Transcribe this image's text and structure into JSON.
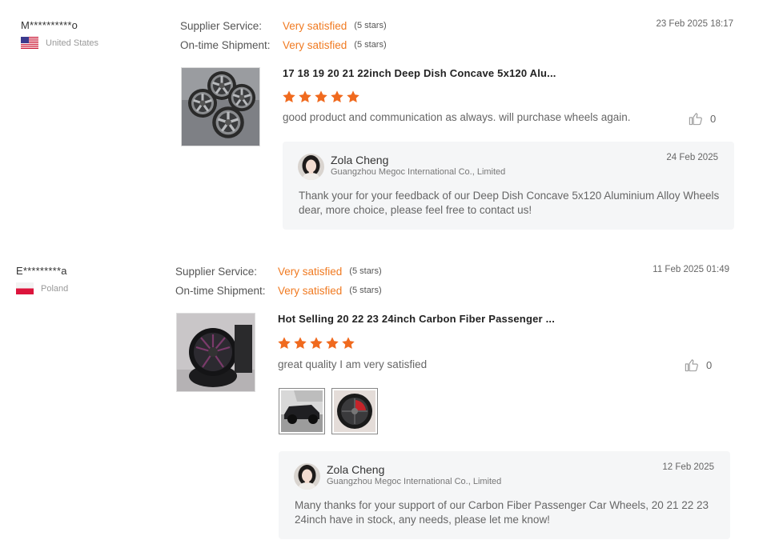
{
  "reviews": [
    {
      "buyer_name": "M**********o",
      "country": "United States",
      "flag": "us-flag",
      "supplier_service_label": "Supplier Service:",
      "supplier_service_value": "Very satisfied",
      "supplier_service_stars": "(5 stars)",
      "shipment_label": "On-time Shipment:",
      "shipment_value": "Very satisfied",
      "shipment_stars": "(5 stars)",
      "date": "23 Feb 2025 18:17",
      "product_title": "17 18 19 20 21 22inch Deep Dish Concave 5x120 Alu...",
      "rating": 5,
      "comment": "good product and communication as always. will purchase wheels again.",
      "likes": "0",
      "reply": {
        "name": "Zola Cheng",
        "company": "Guangzhou Megoc International Co., Limited",
        "date": "24 Feb 2025",
        "text": "Thank your for your feedback of our Deep Dish Concave 5x120 Aluminium Alloy Wheels dear, more choice, please feel free to contact us!"
      }
    },
    {
      "buyer_name": "E*********a",
      "country": "Poland",
      "flag": "poland-flag",
      "supplier_service_label": "Supplier Service:",
      "supplier_service_value": "Very satisfied",
      "supplier_service_stars": "(5 stars)",
      "shipment_label": "On-time Shipment:",
      "shipment_value": "Very satisfied",
      "shipment_stars": "(5 stars)",
      "date": "11 Feb 2025 01:49",
      "product_title": "Hot Selling 20 22 23 24inch Carbon Fiber Passenger ...",
      "rating": 5,
      "comment": "great quality I am very satisfied",
      "likes": "0",
      "reply": {
        "name": "Zola Cheng",
        "company": "Guangzhou Megoc International Co., Limited",
        "date": "12 Feb 2025",
        "text": "Many thanks for your support of our Carbon Fiber Passenger Car Wheels, 20 21 22 23 24inch have in stock, any needs, please let me know!"
      }
    }
  ],
  "colors": {
    "accent": "#f07a21",
    "reply_bg": "#f5f6f7"
  }
}
